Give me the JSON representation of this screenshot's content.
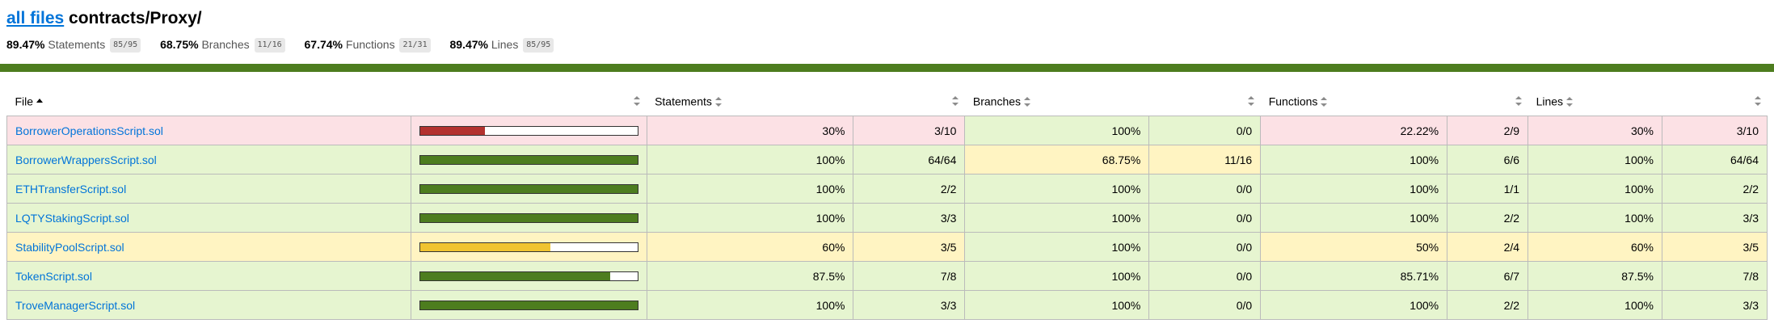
{
  "header": {
    "breadcrumb_link": "all files",
    "breadcrumb_path": "contracts/Proxy/"
  },
  "summary": [
    {
      "pct": "89.47%",
      "label": "Statements",
      "fraction": "85/95"
    },
    {
      "pct": "68.75%",
      "label": "Branches",
      "fraction": "11/16"
    },
    {
      "pct": "67.74%",
      "label": "Functions",
      "fraction": "21/31"
    },
    {
      "pct": "89.47%",
      "label": "Lines",
      "fraction": "85/95"
    }
  ],
  "table": {
    "headers": {
      "file": "File",
      "statements": "Statements",
      "branches": "Branches",
      "functions": "Functions",
      "lines": "Lines"
    },
    "rows": [
      {
        "file": "BorrowerOperationsScript.sol",
        "row_class": "low",
        "coverage": 30,
        "fill_class": "low",
        "st_pct": "30%",
        "st_frac": "3/10",
        "st_class": "low",
        "br_pct": "100%",
        "br_frac": "0/0",
        "br_class": "high",
        "fn_pct": "22.22%",
        "fn_frac": "2/9",
        "fn_class": "low",
        "ln_pct": "30%",
        "ln_frac": "3/10",
        "ln_class": "low"
      },
      {
        "file": "BorrowerWrappersScript.sol",
        "row_class": "high",
        "coverage": 100,
        "fill_class": "high",
        "st_pct": "100%",
        "st_frac": "64/64",
        "st_class": "high",
        "br_pct": "68.75%",
        "br_frac": "11/16",
        "br_class": "medium",
        "fn_pct": "100%",
        "fn_frac": "6/6",
        "fn_class": "high",
        "ln_pct": "100%",
        "ln_frac": "64/64",
        "ln_class": "high"
      },
      {
        "file": "ETHTransferScript.sol",
        "row_class": "high",
        "coverage": 100,
        "fill_class": "high",
        "st_pct": "100%",
        "st_frac": "2/2",
        "st_class": "high",
        "br_pct": "100%",
        "br_frac": "0/0",
        "br_class": "high",
        "fn_pct": "100%",
        "fn_frac": "1/1",
        "fn_class": "high",
        "ln_pct": "100%",
        "ln_frac": "2/2",
        "ln_class": "high"
      },
      {
        "file": "LQTYStakingScript.sol",
        "row_class": "high",
        "coverage": 100,
        "fill_class": "high",
        "st_pct": "100%",
        "st_frac": "3/3",
        "st_class": "high",
        "br_pct": "100%",
        "br_frac": "0/0",
        "br_class": "high",
        "fn_pct": "100%",
        "fn_frac": "2/2",
        "fn_class": "high",
        "ln_pct": "100%",
        "ln_frac": "3/3",
        "ln_class": "high"
      },
      {
        "file": "StabilityPoolScript.sol",
        "row_class": "medium",
        "coverage": 60,
        "fill_class": "medium",
        "st_pct": "60%",
        "st_frac": "3/5",
        "st_class": "medium",
        "br_pct": "100%",
        "br_frac": "0/0",
        "br_class": "high",
        "fn_pct": "50%",
        "fn_frac": "2/4",
        "fn_class": "medium",
        "ln_pct": "60%",
        "ln_frac": "3/5",
        "ln_class": "medium"
      },
      {
        "file": "TokenScript.sol",
        "row_class": "high",
        "coverage": 87.5,
        "fill_class": "high",
        "st_pct": "87.5%",
        "st_frac": "7/8",
        "st_class": "high",
        "br_pct": "100%",
        "br_frac": "0/0",
        "br_class": "high",
        "fn_pct": "85.71%",
        "fn_frac": "6/7",
        "fn_class": "high",
        "ln_pct": "87.5%",
        "ln_frac": "7/8",
        "ln_class": "high"
      },
      {
        "file": "TroveManagerScript.sol",
        "row_class": "high",
        "coverage": 100,
        "fill_class": "high",
        "st_pct": "100%",
        "st_frac": "3/3",
        "st_class": "high",
        "br_pct": "100%",
        "br_frac": "0/0",
        "br_class": "high",
        "fn_pct": "100%",
        "fn_frac": "2/2",
        "fn_class": "high",
        "ln_pct": "100%",
        "ln_frac": "3/3",
        "ln_class": "high"
      }
    ]
  },
  "colors": {
    "status_line": "#4d7d1f",
    "high_bg": "#e6f5d0",
    "medium_bg": "#fff4c2",
    "low_bg": "#fce1e5",
    "high_fill": "#4d7d1f",
    "medium_fill": "#f0c430",
    "low_fill": "#b3322f",
    "link": "#0074D9"
  }
}
